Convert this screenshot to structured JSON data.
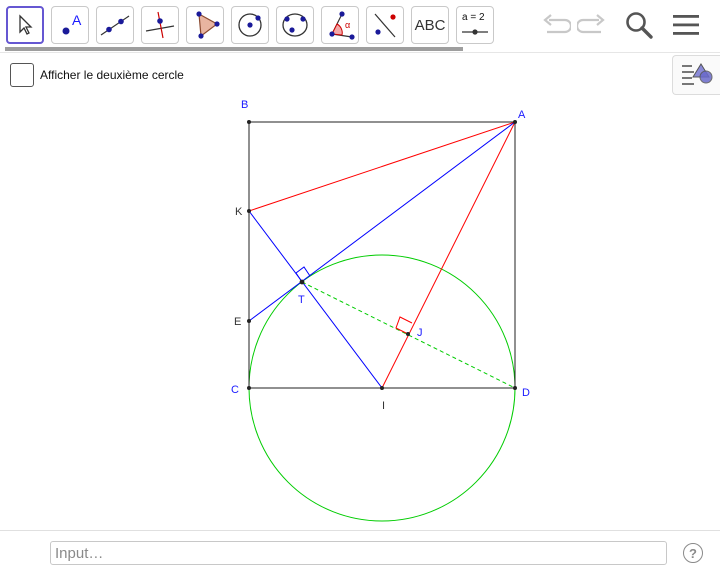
{
  "toolbar": {
    "tools": [
      {
        "name": "move",
        "icon": "cursor-arrow-icon",
        "active": true
      },
      {
        "name": "point",
        "icon": "point-icon",
        "label": "A"
      },
      {
        "name": "line",
        "icon": "line-through-points-icon"
      },
      {
        "name": "perpendicular",
        "icon": "perpendicular-line-icon"
      },
      {
        "name": "polygon",
        "icon": "polygon-icon"
      },
      {
        "name": "circle-center-point",
        "icon": "circle-center-point-icon"
      },
      {
        "name": "circle-three-points",
        "icon": "circle-three-points-icon"
      },
      {
        "name": "angle",
        "icon": "angle-icon",
        "label": "α"
      },
      {
        "name": "reflect",
        "icon": "reflect-icon"
      },
      {
        "name": "text",
        "icon": "text-icon",
        "label": "ABC"
      },
      {
        "name": "slider",
        "icon": "slider-icon",
        "label": "a = 2"
      }
    ],
    "undo_icon": "undo-icon",
    "redo_icon": "redo-icon",
    "search_icon": "search-icon",
    "menu_icon": "hamburger-menu-icon"
  },
  "algebra_toggle": {
    "icon": "algebra-view-icon"
  },
  "checkbox": {
    "label": "Afficher le deuxième cercle",
    "checked": false
  },
  "figure": {
    "points": {
      "A": "A",
      "B": "B",
      "C": "C",
      "D": "D",
      "K": "K",
      "E": "E",
      "T": "T",
      "J": "J",
      "I": "I"
    }
  },
  "input_bar": {
    "placeholder": "Input…",
    "value": "",
    "help": "?"
  },
  "colors": {
    "accent": "#6557d2",
    "point_label": "#1a1aff",
    "square": "#222222",
    "red": "#ff0000",
    "blue": "#0000ff",
    "green": "#00cc00"
  }
}
